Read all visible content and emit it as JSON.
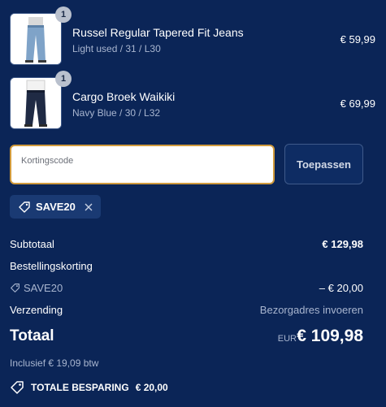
{
  "cart": {
    "items": [
      {
        "name": "Russel Regular Tapered Fit Jeans",
        "variant": "Light used / 31 / L30",
        "price": "€ 59,99",
        "quantity": "1"
      },
      {
        "name": "Cargo Broek Waikiki",
        "variant": "Navy Blue / 30 / L32",
        "price": "€ 69,99",
        "quantity": "1"
      }
    ]
  },
  "discount": {
    "placeholder": "Kortingscode",
    "apply_label": "Toepassen",
    "applied_code": "SAVE20"
  },
  "summary": {
    "subtotal_label": "Subtotaal",
    "subtotal_value": "€ 129,98",
    "order_discount_label": "Bestellingskorting",
    "discount_code": "SAVE20",
    "discount_value": "– € 20,00",
    "shipping_label": "Verzending",
    "shipping_value": "Bezorgadres invoeren",
    "total_label": "Totaal",
    "currency": "EUR",
    "total_value": "€ 109,98",
    "tax_note": "Inclusief € 19,09 btw",
    "savings_label": "TOTALE BESPARING",
    "savings_value": "€ 20,00"
  },
  "colors": {
    "background": "#0b2557",
    "input_focus_border": "#d09a3c",
    "chip_background": "#1a3a73",
    "muted_text": "#a8b5cf"
  },
  "icons": [
    "tag-icon",
    "close-icon"
  ]
}
